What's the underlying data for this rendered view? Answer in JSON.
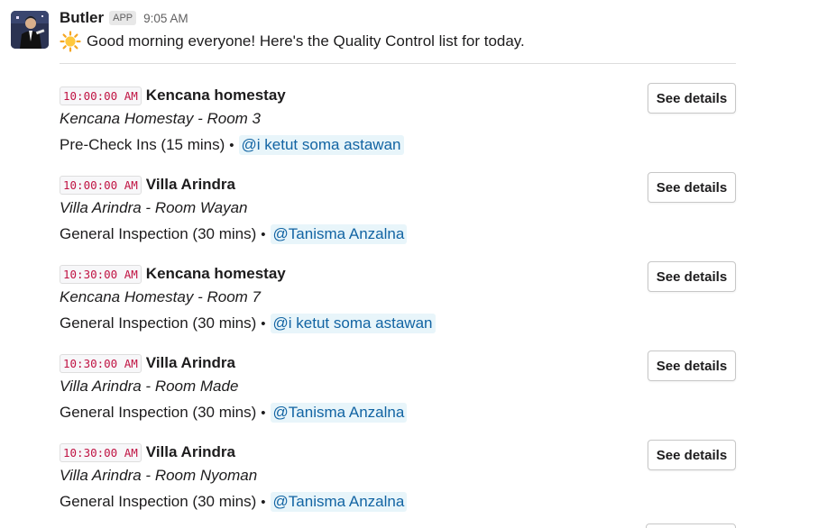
{
  "message": {
    "sender": "Butler",
    "app_badge": "APP",
    "timestamp": "9:05 AM",
    "emoji": "sun-icon",
    "greeting": "Good morning everyone! Here's the Quality Control list for today."
  },
  "tasks": [
    {
      "time": "10:00:00 AM",
      "property": "Kencana homestay",
      "room": "Kencana Homestay - Room 3",
      "inspection": "Pre-Check Ins (15 mins)",
      "bullet": "•",
      "assignee": "@i ketut soma astawan",
      "button": "See details"
    },
    {
      "time": "10:00:00 AM",
      "property": "Villa Arindra",
      "room": "Villa Arindra - Room Wayan",
      "inspection": "General Inspection (30 mins)",
      "bullet": "•",
      "assignee": "@Tanisma Anzalna",
      "button": "See details"
    },
    {
      "time": "10:30:00 AM",
      "property": "Kencana homestay",
      "room": "Kencana Homestay - Room 7",
      "inspection": "General Inspection (30 mins)",
      "bullet": "•",
      "assignee": "@i ketut soma astawan",
      "button": "See details"
    },
    {
      "time": "10:30:00 AM",
      "property": "Villa Arindra",
      "room": "Villa Arindra - Room Made",
      "inspection": "General Inspection (30 mins)",
      "bullet": "•",
      "assignee": "@Tanisma Anzalna",
      "button": "See details"
    },
    {
      "time": "10:30:00 AM",
      "property": "Villa Arindra",
      "room": "Villa Arindra - Room Nyoman",
      "inspection": "General Inspection (30 mins)",
      "bullet": "•",
      "assignee": "@Tanisma Anzalna",
      "button": "See details"
    }
  ]
}
